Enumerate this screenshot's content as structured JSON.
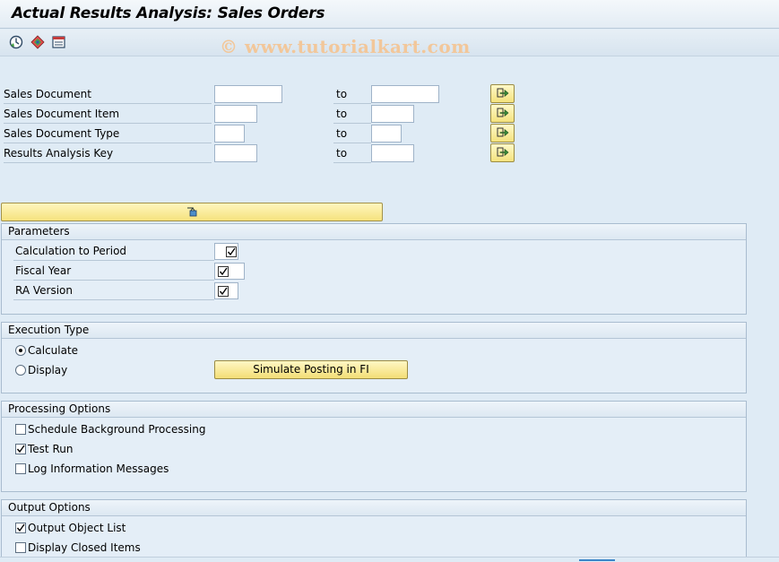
{
  "window": {
    "title": "Actual Results Analysis: Sales Orders"
  },
  "toolbar": {
    "icons": [
      "execute-icon",
      "variant-icon",
      "save-variant-icon"
    ],
    "watermark": "© www.tutorialkart.com"
  },
  "selection": {
    "to_label": "to",
    "rows": [
      {
        "label": "Sales Document",
        "from_value": "",
        "to_value": ""
      },
      {
        "label": "Sales Document Item",
        "from_value": "",
        "to_value": ""
      },
      {
        "label": "Sales Document Type",
        "from_value": "",
        "to_value": ""
      },
      {
        "label": "Results Analysis Key",
        "from_value": "",
        "to_value": ""
      }
    ]
  },
  "parameters": {
    "title": "Parameters",
    "fields": [
      {
        "label": "Calculation to Period",
        "checked": true
      },
      {
        "label": "Fiscal Year",
        "checked": true
      },
      {
        "label": "RA Version",
        "checked": true
      }
    ]
  },
  "execution_type": {
    "title": "Execution Type",
    "options": [
      {
        "label": "Calculate",
        "selected": true
      },
      {
        "label": "Display",
        "selected": false
      }
    ],
    "simulate_button": "Simulate Posting in FI"
  },
  "processing_options": {
    "title": "Processing Options",
    "items": [
      {
        "label": "Schedule Background Processing",
        "checked": false
      },
      {
        "label": "Test Run",
        "checked": true
      },
      {
        "label": "Log Information Messages",
        "checked": false
      }
    ]
  },
  "output_options": {
    "title": "Output Options",
    "items": [
      {
        "label": "Output Object List",
        "checked": true
      },
      {
        "label": "Display Closed Items",
        "checked": false
      }
    ]
  },
  "colors": {
    "background": "#dfebf5",
    "button_yellow": "#f5e27e",
    "accent": "#3a86c8"
  }
}
